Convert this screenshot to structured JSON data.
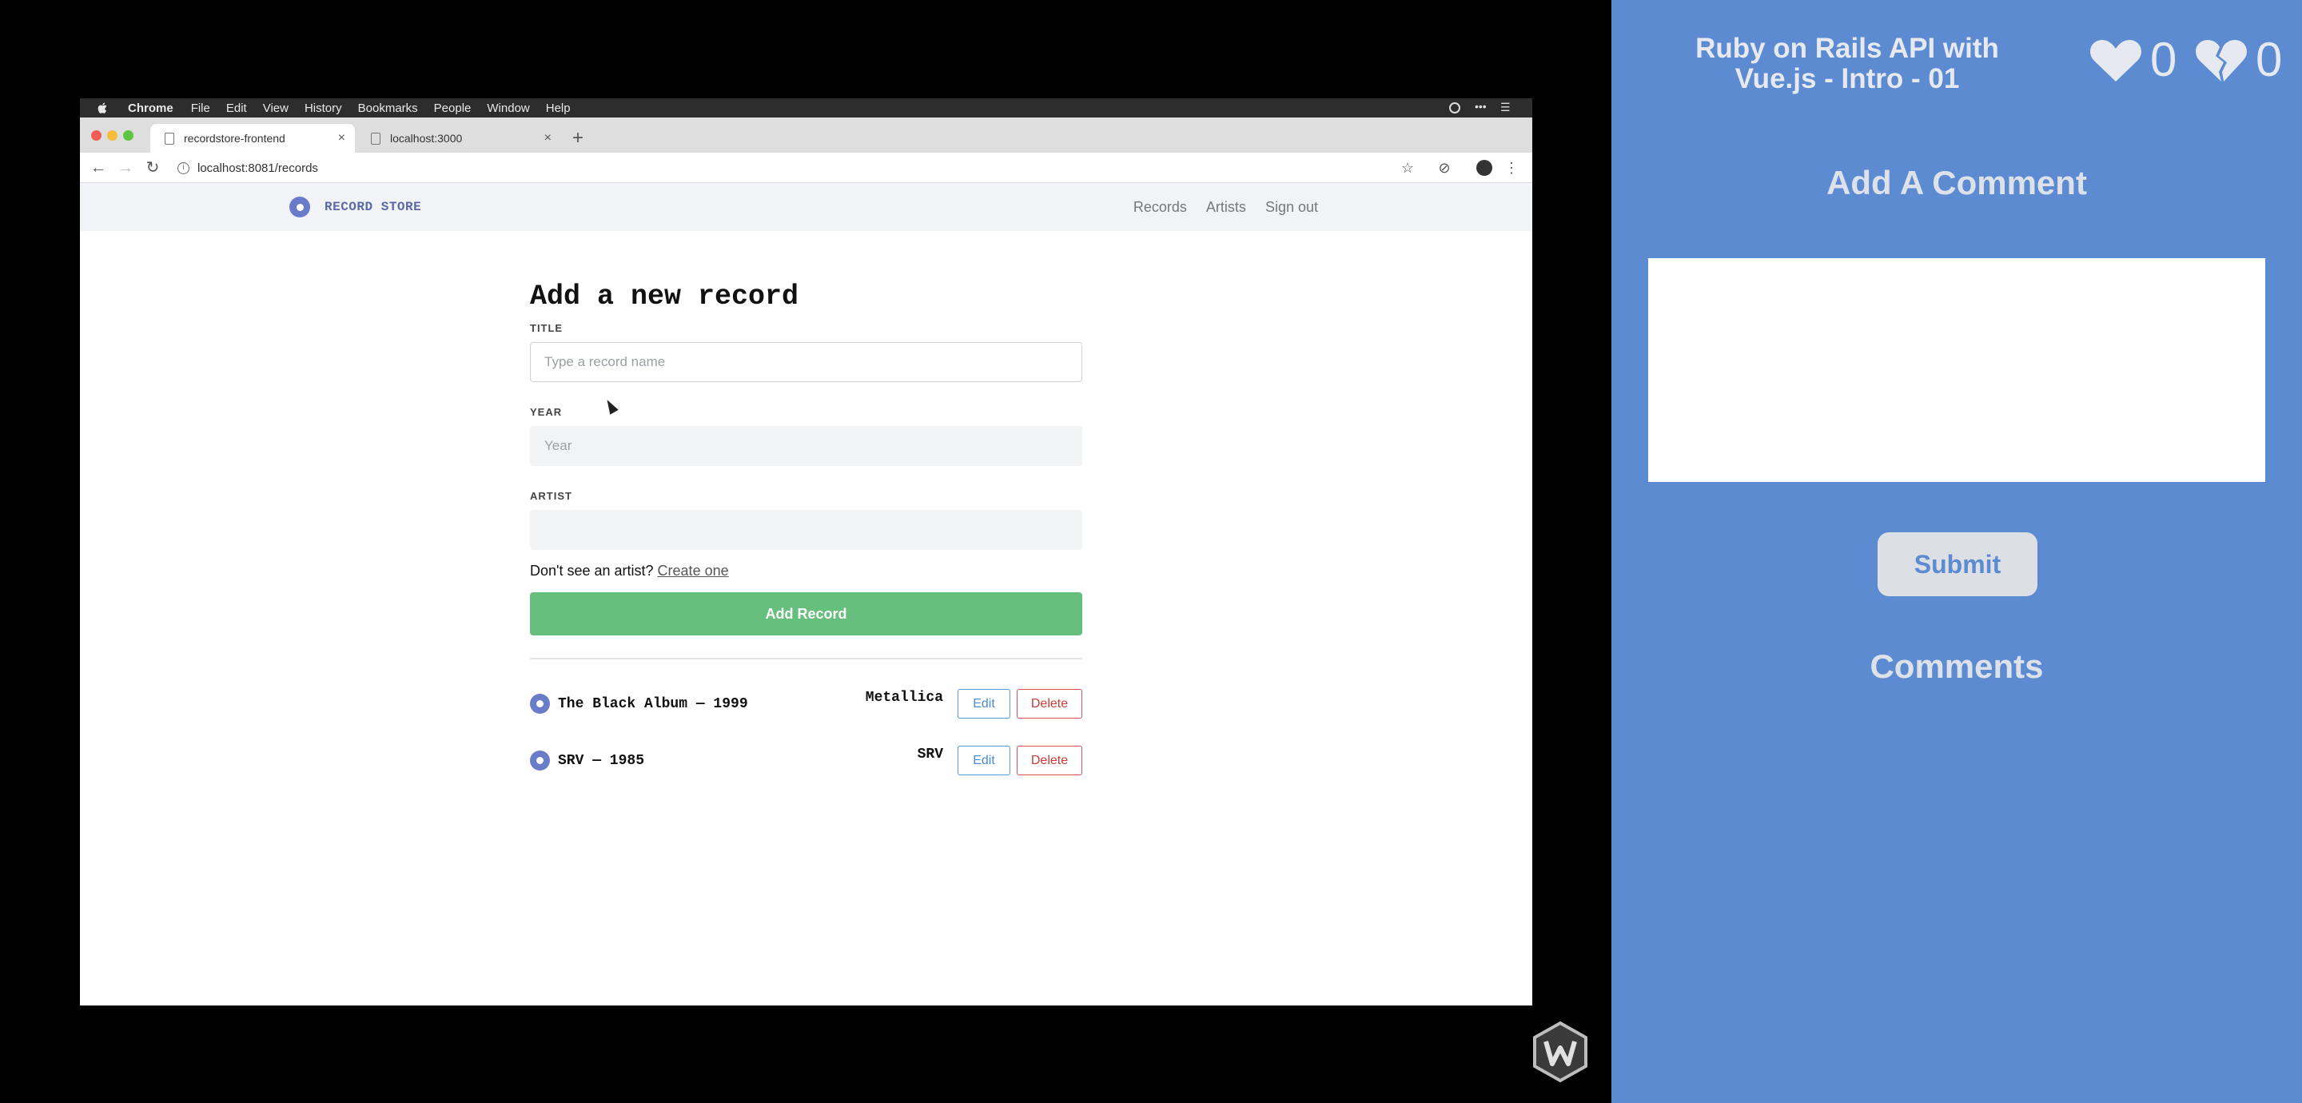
{
  "mac_menu": {
    "app": "Chrome",
    "items": [
      "File",
      "Edit",
      "View",
      "History",
      "Bookmarks",
      "People",
      "Window",
      "Help"
    ]
  },
  "browser": {
    "tabs": [
      {
        "label": "recordstore-frontend",
        "active": true
      },
      {
        "label": "localhost:3000",
        "active": false
      }
    ],
    "url": "localhost:8081/records"
  },
  "app": {
    "logo_text": "RECORD STORE",
    "nav": [
      "Records",
      "Artists",
      "Sign out"
    ],
    "form": {
      "heading": "Add a new record",
      "title_label": "TITLE",
      "title_placeholder": "Type a record name",
      "year_label": "YEAR",
      "year_placeholder": "Year",
      "artist_label": "ARTIST",
      "hint_text": "Don't see an artist?",
      "hint_link": "Create one",
      "submit_label": "Add Record"
    },
    "records": [
      {
        "title": "The Black Album — 1999",
        "artist": "Metallica",
        "edit": "Edit",
        "delete": "Delete"
      },
      {
        "title": "SRV — 1985",
        "artist": "SRV",
        "edit": "Edit",
        "delete": "Delete"
      }
    ]
  },
  "panel": {
    "video_title": "Ruby on Rails API with Vue.js - Intro - 01",
    "likes": "0",
    "dislikes": "0",
    "add_comment_heading": "Add A Comment",
    "submit_label": "Submit",
    "comments_heading": "Comments",
    "accent_color": "#5c8bd2"
  }
}
